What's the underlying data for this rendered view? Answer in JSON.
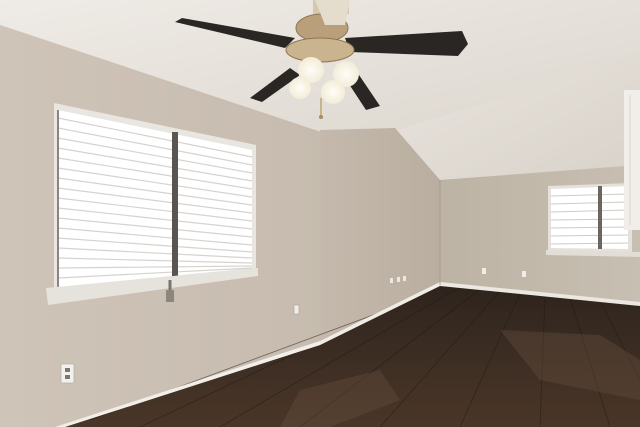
{
  "scene": {
    "subject": "empty-room",
    "colors": {
      "ceiling": "#ece8e3",
      "ceiling_far": "#e6e1da",
      "wall_left": "#cbc0b4",
      "wall_center": "#c3b8ab",
      "wall_right": "#c2b9ab",
      "floor": "#3a2a20",
      "baseboard": "#f2efea",
      "window_glass": "#ffffff",
      "fan_blade": "#2a2624",
      "fan_brass": "#b9a07a"
    }
  }
}
